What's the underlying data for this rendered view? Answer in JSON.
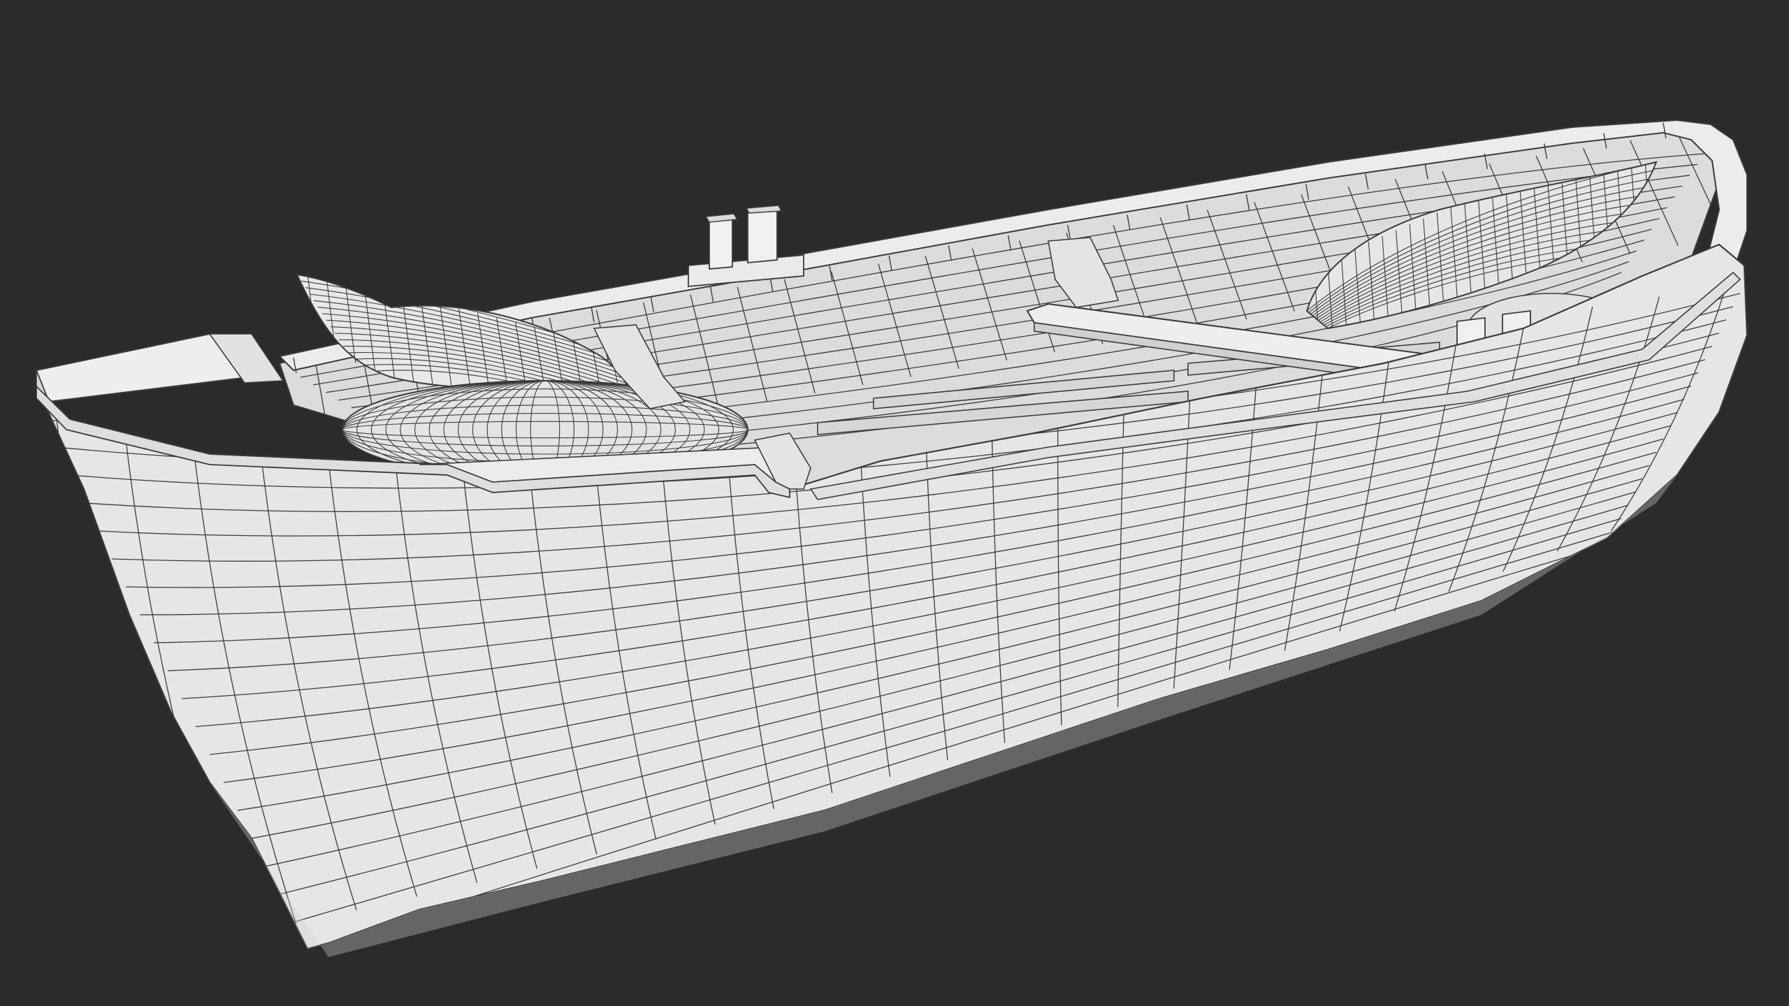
{
  "scene": {
    "subject": "wireframe-rowboat",
    "render_mode": "wireframe-on-shaded",
    "colors": {
      "background": "#2b2b2b",
      "surface": "#e6e6e6",
      "surface_shadow": "#cfcfcf",
      "surface_light": "#f0f0f0",
      "wire": "#3a3a3a"
    }
  }
}
